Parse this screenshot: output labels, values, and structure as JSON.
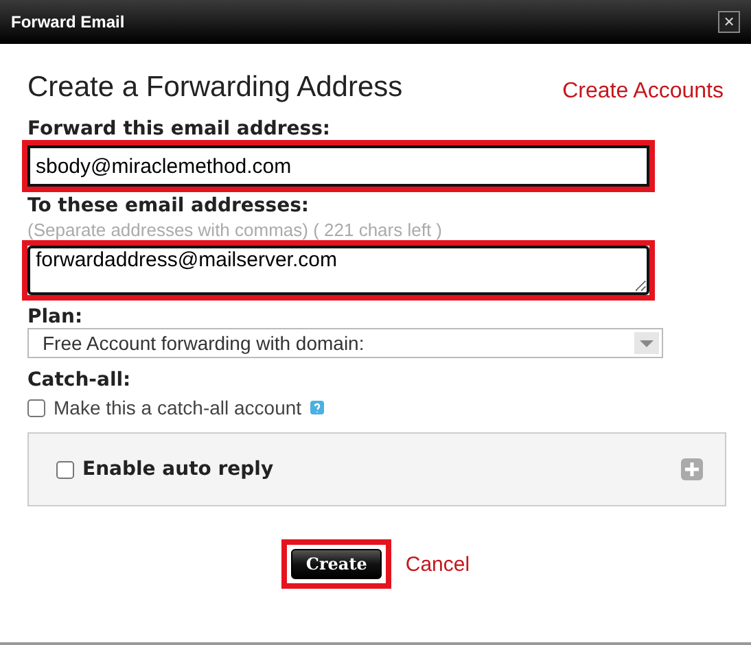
{
  "window": {
    "title": "Forward Email",
    "close": "×"
  },
  "heading": "Create a Forwarding Address",
  "create_accounts_link": "Create Accounts",
  "forward_field": {
    "label": "Forward this email address:",
    "value": "sbody@miraclemethod.com",
    "highlighted": true
  },
  "to_field": {
    "label": "To these email addresses:",
    "hint": "(Separate addresses with commas) ( 221 chars left )",
    "value": "forwardaddress@mailserver.com",
    "highlighted": true
  },
  "plan": {
    "label": "Plan:",
    "value": "Free Account forwarding with domain:"
  },
  "catch_all": {
    "label": "Catch-all:",
    "option": "Make this a catch-all account",
    "checked": false
  },
  "auto_reply": {
    "label": "Enable auto reply",
    "checked": false,
    "expanded": false
  },
  "buttons": {
    "create": "Create",
    "create_highlighted": true,
    "cancel": "Cancel"
  }
}
